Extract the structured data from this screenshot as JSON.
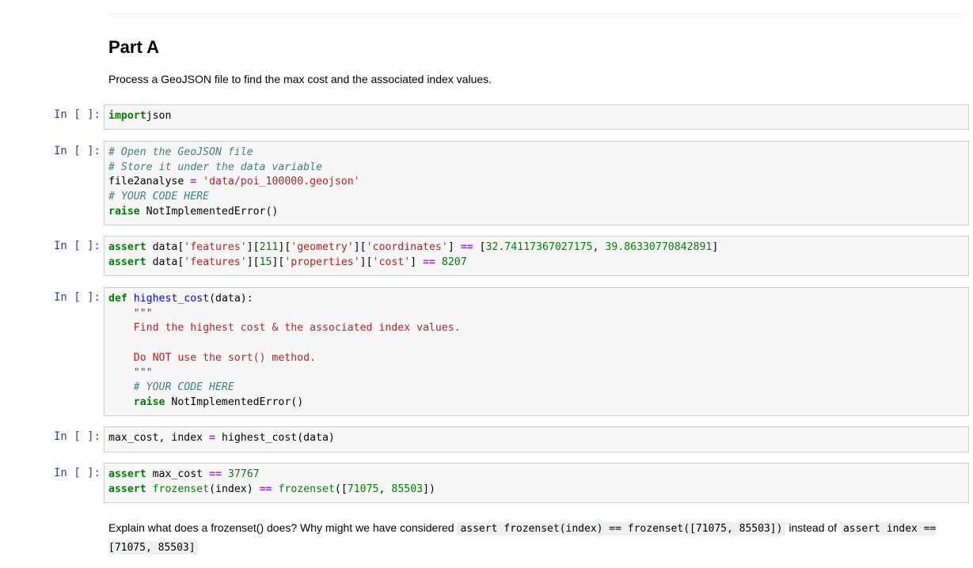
{
  "markdown": {
    "heading": "Part A",
    "intro": "Process a GeoJSON file to find the max cost and the associated index values."
  },
  "cells": [
    {
      "prompt": "In [ ]:",
      "lines": [
        [
          [
            "kw",
            "import"
          ],
          [
            "",
            "json"
          ]
        ]
      ]
    },
    {
      "prompt": "In [ ]:",
      "lines": [
        [
          [
            "cm",
            "# Open the GeoJSON file"
          ]
        ],
        [
          [
            "cm",
            "# Store it under the data variable"
          ]
        ],
        [
          [
            "",
            "file2analyse "
          ],
          [
            "op",
            "="
          ],
          [
            "",
            " "
          ],
          [
            "st",
            "'data/poi_100000.geojson'"
          ]
        ],
        [
          [
            "cm",
            "# YOUR CODE HERE"
          ]
        ],
        [
          [
            "kw",
            "raise"
          ],
          [
            "",
            " NotImplementedError()"
          ]
        ]
      ]
    },
    {
      "prompt": "In [ ]:",
      "lines": [
        [
          [
            "kw",
            "assert"
          ],
          [
            "",
            " data["
          ],
          [
            "st",
            "'features'"
          ],
          [
            "",
            "]["
          ],
          [
            "nu",
            "211"
          ],
          [
            "",
            "]["
          ],
          [
            "st",
            "'geometry'"
          ],
          [
            "",
            "]["
          ],
          [
            "st",
            "'coordinates'"
          ],
          [
            "",
            "] "
          ],
          [
            "op",
            "=="
          ],
          [
            "",
            " ["
          ],
          [
            "nu",
            "32.74117367027175"
          ],
          [
            "",
            ", "
          ],
          [
            "nu",
            "39.86330770842891"
          ],
          [
            "",
            "]"
          ]
        ],
        [
          [
            "kw",
            "assert"
          ],
          [
            "",
            " data["
          ],
          [
            "st",
            "'features'"
          ],
          [
            "",
            "]["
          ],
          [
            "nu",
            "15"
          ],
          [
            "",
            "]["
          ],
          [
            "st",
            "'properties'"
          ],
          [
            "",
            "]["
          ],
          [
            "st",
            "'cost'"
          ],
          [
            "",
            "] "
          ],
          [
            "op",
            "=="
          ],
          [
            "",
            " "
          ],
          [
            "nu",
            "8207"
          ]
        ]
      ]
    },
    {
      "prompt": "In [ ]:",
      "lines": [
        [
          [
            "kw",
            "def"
          ],
          [
            "",
            " "
          ],
          [
            "fn",
            "highest_cost"
          ],
          [
            "",
            "(data):"
          ]
        ],
        [
          [
            "",
            "    "
          ],
          [
            "st",
            "\"\"\""
          ]
        ],
        [
          [
            "st",
            "    Find the highest cost & the associated index values."
          ]
        ],
        [
          [
            "",
            ""
          ]
        ],
        [
          [
            "st",
            "    Do NOT use the sort() method."
          ]
        ],
        [
          [
            "",
            "    "
          ],
          [
            "st",
            "\"\"\""
          ]
        ],
        [
          [
            "",
            "    "
          ],
          [
            "cm",
            "# YOUR CODE HERE"
          ]
        ],
        [
          [
            "",
            "    "
          ],
          [
            "kw",
            "raise"
          ],
          [
            "",
            " NotImplementedError()"
          ]
        ]
      ]
    },
    {
      "prompt": "In [ ]:",
      "lines": [
        [
          [
            "",
            "max_cost, index "
          ],
          [
            "op",
            "="
          ],
          [
            "",
            " highest_cost(data)"
          ]
        ]
      ]
    },
    {
      "prompt": "In [ ]:",
      "lines": [
        [
          [
            "kw",
            "assert"
          ],
          [
            "",
            " max_cost "
          ],
          [
            "op",
            "=="
          ],
          [
            "",
            " "
          ],
          [
            "nu",
            "37767"
          ]
        ],
        [
          [
            "kw",
            "assert"
          ],
          [
            "",
            " "
          ],
          [
            "bi",
            "frozenset"
          ],
          [
            "",
            "(index) "
          ],
          [
            "op",
            "=="
          ],
          [
            "",
            " "
          ],
          [
            "bi",
            "frozenset"
          ],
          [
            "",
            "(["
          ],
          [
            "nu",
            "71075"
          ],
          [
            "",
            ", "
          ],
          [
            "nu",
            "85503"
          ],
          [
            "",
            "])"
          ]
        ]
      ]
    }
  ],
  "explain": {
    "text1": "Explain what does a frozenset() does? Why might we have considered ",
    "code1": "assert frozenset(index) == frozenset([71075, 85503])",
    "text2": " instead of ",
    "code2": "assert index == [71075, 85503]"
  },
  "colors": {
    "prompt": "#303f9f",
    "cell_bg": "#f7f7f7",
    "cell_border": "#cfcfcf",
    "keyword": "#008000",
    "comment": "#408080",
    "string": "#ba2121",
    "operator": "#aa22ff",
    "function_name": "#0000ff"
  }
}
